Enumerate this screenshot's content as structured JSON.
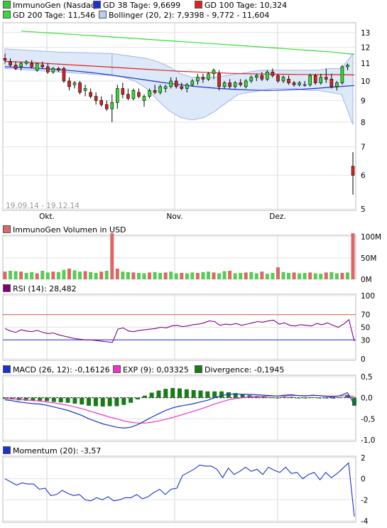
{
  "legend_main": {
    "stock": {
      "label": "ImmunoGen (Nasdaq)",
      "color": "#33cc33"
    },
    "gd38": {
      "label": "GD 38 Tage: 9,6699",
      "color": "#1a33cc"
    },
    "gd100": {
      "label": "GD 100 Tage: 10,324",
      "color": "#dd2222"
    },
    "gd200": {
      "label": "GD 200 Tage: 11,546",
      "color": "#33dd33"
    },
    "bollinger": {
      "label": "Bollinger (20, 2): 7,9398 - 9,772 - 11,604",
      "color": "#b8cff0"
    }
  },
  "date_range": "19.09.14 - 19.12.14",
  "x_labels": [
    "Okt.",
    "Nov.",
    "Dez."
  ],
  "main_y_ticks": [
    "13",
    "12",
    "11",
    "10",
    "9",
    "8",
    "7",
    "6",
    "5"
  ],
  "volume": {
    "label": "ImmunoGen Volumen in USD",
    "ticks": [
      "100M",
      "50M",
      "0M"
    ]
  },
  "rsi": {
    "label": "RSI (14): 28,482",
    "ticks": [
      "100",
      "70",
      "50",
      "30",
      "0"
    ],
    "color": "#800080"
  },
  "macd": {
    "macd_label": "MACD (26, 12): -0,16126",
    "exp_label": "EXP (9): 0,03325",
    "div_label": "Divergence: -0,1945",
    "ticks": [
      "0,5",
      "0,0",
      "-0,5",
      "-1,0"
    ],
    "macd_color": "#1a33cc",
    "exp_color": "#ee33cc",
    "div_color": "#1a7a1a"
  },
  "momentum": {
    "label": "Momentum (20): -3,57",
    "ticks": [
      "2",
      "0",
      "-2",
      "-4"
    ],
    "color": "#1a33cc"
  },
  "chart_data": [
    {
      "type": "candlestick",
      "title": "ImmunoGen (Nasdaq)",
      "x_range": [
        "19.09.14",
        "19.12.14"
      ],
      "y_range": [
        5,
        13.5
      ],
      "y_scale": "log",
      "candles": [
        {
          "o": 11.3,
          "h": 11.6,
          "l": 11.0,
          "c": 11.2
        },
        {
          "o": 11.1,
          "h": 11.3,
          "l": 10.8,
          "c": 10.9
        },
        {
          "o": 10.9,
          "h": 11.1,
          "l": 10.6,
          "c": 10.7
        },
        {
          "o": 10.8,
          "h": 11.1,
          "l": 10.6,
          "c": 11.0
        },
        {
          "o": 11.0,
          "h": 11.2,
          "l": 10.9,
          "c": 11.1
        },
        {
          "o": 11.0,
          "h": 11.2,
          "l": 10.7,
          "c": 10.8
        },
        {
          "o": 10.6,
          "h": 11.0,
          "l": 10.5,
          "c": 11.0
        },
        {
          "o": 10.9,
          "h": 11.1,
          "l": 10.7,
          "c": 10.8
        },
        {
          "o": 10.8,
          "h": 11.0,
          "l": 10.4,
          "c": 10.5
        },
        {
          "o": 10.5,
          "h": 10.8,
          "l": 10.4,
          "c": 10.7
        },
        {
          "o": 10.7,
          "h": 10.8,
          "l": 10.5,
          "c": 10.6
        },
        {
          "o": 10.7,
          "h": 10.8,
          "l": 9.9,
          "c": 10.0
        },
        {
          "o": 10.0,
          "h": 10.2,
          "l": 9.5,
          "c": 9.7
        },
        {
          "o": 9.8,
          "h": 10.0,
          "l": 9.6,
          "c": 9.9
        },
        {
          "o": 9.9,
          "h": 10.0,
          "l": 9.3,
          "c": 9.4
        },
        {
          "o": 9.5,
          "h": 9.8,
          "l": 9.2,
          "c": 9.6
        },
        {
          "o": 9.4,
          "h": 9.6,
          "l": 9.1,
          "c": 9.2
        },
        {
          "o": 9.2,
          "h": 9.4,
          "l": 8.8,
          "c": 9.0
        },
        {
          "o": 9.0,
          "h": 9.2,
          "l": 8.7,
          "c": 8.8
        },
        {
          "o": 8.8,
          "h": 9.0,
          "l": 8.5,
          "c": 8.6
        },
        {
          "o": 8.6,
          "h": 9.3,
          "l": 8.0,
          "c": 8.9
        },
        {
          "o": 8.9,
          "h": 9.8,
          "l": 8.6,
          "c": 9.6
        },
        {
          "o": 9.6,
          "h": 9.9,
          "l": 9.1,
          "c": 9.3
        },
        {
          "o": 9.3,
          "h": 9.6,
          "l": 9.0,
          "c": 9.1
        },
        {
          "o": 9.1,
          "h": 9.6,
          "l": 9.0,
          "c": 9.5
        },
        {
          "o": 9.4,
          "h": 9.6,
          "l": 9.1,
          "c": 9.2
        },
        {
          "o": 9.0,
          "h": 9.3,
          "l": 8.7,
          "c": 9.2
        },
        {
          "o": 9.2,
          "h": 9.6,
          "l": 9.1,
          "c": 9.5
        },
        {
          "o": 9.5,
          "h": 9.8,
          "l": 9.3,
          "c": 9.4
        },
        {
          "o": 9.4,
          "h": 9.8,
          "l": 9.3,
          "c": 9.7
        },
        {
          "o": 9.6,
          "h": 9.8,
          "l": 9.4,
          "c": 9.7
        },
        {
          "o": 9.7,
          "h": 10.2,
          "l": 9.6,
          "c": 10.0
        },
        {
          "o": 10.0,
          "h": 10.2,
          "l": 9.6,
          "c": 9.7
        },
        {
          "o": 9.7,
          "h": 9.9,
          "l": 9.5,
          "c": 9.6
        },
        {
          "o": 9.6,
          "h": 9.9,
          "l": 9.4,
          "c": 9.8
        },
        {
          "o": 9.8,
          "h": 10.1,
          "l": 9.7,
          "c": 10.0
        },
        {
          "o": 10.0,
          "h": 10.4,
          "l": 9.8,
          "c": 10.2
        },
        {
          "o": 10.2,
          "h": 10.4,
          "l": 9.9,
          "c": 10.1
        },
        {
          "o": 10.1,
          "h": 10.5,
          "l": 10.0,
          "c": 10.4
        },
        {
          "o": 10.4,
          "h": 10.7,
          "l": 10.1,
          "c": 10.6
        },
        {
          "o": 10.4,
          "h": 10.6,
          "l": 9.5,
          "c": 9.7
        },
        {
          "o": 9.7,
          "h": 10.0,
          "l": 9.6,
          "c": 9.9
        },
        {
          "o": 9.9,
          "h": 10.1,
          "l": 9.6,
          "c": 9.7
        },
        {
          "o": 9.7,
          "h": 10.0,
          "l": 9.6,
          "c": 9.9
        },
        {
          "o": 9.9,
          "h": 10.1,
          "l": 9.7,
          "c": 9.8
        },
        {
          "o": 9.7,
          "h": 10.1,
          "l": 9.6,
          "c": 10.0
        },
        {
          "o": 10.0,
          "h": 10.3,
          "l": 9.9,
          "c": 10.2
        },
        {
          "o": 10.2,
          "h": 10.4,
          "l": 10.0,
          "c": 10.3
        },
        {
          "o": 10.3,
          "h": 10.5,
          "l": 10.0,
          "c": 10.1
        },
        {
          "o": 10.1,
          "h": 10.6,
          "l": 10.0,
          "c": 10.5
        },
        {
          "o": 10.5,
          "h": 10.7,
          "l": 10.2,
          "c": 10.3
        },
        {
          "o": 10.3,
          "h": 10.4,
          "l": 9.9,
          "c": 10.0
        },
        {
          "o": 10.0,
          "h": 10.3,
          "l": 9.9,
          "c": 10.2
        },
        {
          "o": 10.1,
          "h": 10.3,
          "l": 9.8,
          "c": 9.9
        },
        {
          "o": 9.9,
          "h": 10.0,
          "l": 9.7,
          "c": 9.8
        },
        {
          "o": 9.8,
          "h": 10.0,
          "l": 9.7,
          "c": 9.9
        },
        {
          "o": 9.8,
          "h": 10.0,
          "l": 9.7,
          "c": 9.8
        },
        {
          "o": 9.8,
          "h": 10.4,
          "l": 9.7,
          "c": 10.3
        },
        {
          "o": 10.3,
          "h": 10.4,
          "l": 9.8,
          "c": 9.9
        },
        {
          "o": 9.9,
          "h": 10.4,
          "l": 9.8,
          "c": 10.2
        },
        {
          "o": 10.2,
          "h": 10.7,
          "l": 9.9,
          "c": 10.1
        },
        {
          "o": 10.1,
          "h": 10.4,
          "l": 9.6,
          "c": 9.7
        },
        {
          "o": 9.7,
          "h": 10.0,
          "l": 9.5,
          "c": 9.9
        },
        {
          "o": 9.9,
          "h": 10.9,
          "l": 9.8,
          "c": 10.8
        },
        {
          "o": 10.8,
          "h": 11.0,
          "l": 10.6,
          "c": 10.9
        },
        {
          "o": 6.3,
          "h": 6.8,
          "l": 5.4,
          "c": 6.0
        }
      ],
      "gd38": [
        10.8,
        10.76,
        10.7,
        10.64,
        10.56,
        10.46,
        10.34,
        10.2,
        10.06,
        9.92,
        9.8,
        9.7,
        9.62,
        9.56,
        9.52,
        9.5,
        9.52,
        9.56,
        9.62,
        9.69,
        9.76
      ],
      "gd100": [
        11.12,
        11.08,
        11.02,
        10.96,
        10.9,
        10.84,
        10.78,
        10.72,
        10.66,
        10.6,
        10.54,
        10.5,
        10.46,
        10.42,
        10.4,
        10.38,
        10.37,
        10.36,
        10.35,
        10.35,
        10.33
      ],
      "gd200": [
        13.1,
        13.0,
        12.9,
        12.8,
        12.7,
        12.6,
        12.5,
        12.4,
        12.3,
        12.2,
        12.1,
        12.0,
        11.9,
        11.8,
        11.7,
        11.55
      ],
      "bollinger_upper": [
        11.6,
        11.5,
        11.4,
        11.3,
        11.1,
        10.8,
        10.4,
        10.2,
        10.2,
        10.2,
        10.3,
        10.4,
        10.5,
        10.6,
        10.6,
        10.6,
        10.6,
        10.6,
        10.6,
        10.7,
        10.7,
        11.6
      ],
      "bollinger_lower": [
        10.3,
        10.2,
        10.0,
        9.6,
        9.0,
        8.5,
        8.2,
        8.1,
        8.2,
        8.5,
        8.9,
        9.3,
        9.4,
        9.5,
        9.6,
        9.6,
        9.6,
        9.5,
        9.5,
        9.4,
        9.3,
        7.9
      ]
    },
    {
      "type": "bar",
      "title": "ImmunoGen Volumen in USD",
      "y_range": [
        0,
        100
      ],
      "values": [
        18,
        20,
        19,
        18,
        15,
        17,
        14,
        20,
        16,
        18,
        17,
        22,
        25,
        21,
        18,
        19,
        17,
        15,
        18,
        20,
        108,
        25,
        18,
        17,
        16,
        15,
        14,
        16,
        17,
        15,
        16,
        18,
        14,
        15,
        14,
        16,
        15,
        17,
        18,
        16,
        14,
        19,
        20,
        14,
        15,
        16,
        17,
        14,
        18,
        13,
        15,
        28,
        17,
        15,
        16,
        14,
        15,
        16,
        14,
        13,
        16,
        17,
        14,
        15,
        16,
        108
      ],
      "up_color": "#55cc55",
      "down_color": "#dd6666"
    },
    {
      "type": "line",
      "title": "RSI (14): 28,482",
      "y_range": [
        0,
        100
      ],
      "reference_lines": [
        70,
        30
      ],
      "values": [
        48,
        44,
        42,
        46,
        44,
        43,
        45,
        42,
        40,
        41,
        38,
        36,
        34,
        32,
        31,
        30,
        30,
        29,
        28,
        27,
        26,
        47,
        49,
        44,
        43,
        45,
        46,
        47,
        48,
        50,
        49,
        52,
        53,
        51,
        52,
        54,
        55,
        57,
        60,
        59,
        53,
        55,
        54,
        56,
        53,
        55,
        57,
        59,
        58,
        60,
        61,
        55,
        57,
        53,
        52,
        54,
        53,
        52,
        56,
        54,
        57,
        53,
        50,
        55,
        62,
        28
      ]
    },
    {
      "type": "line",
      "title": "MACD (26, 12)",
      "y_range": [
        -1.0,
        0.5
      ],
      "series": [
        {
          "name": "MACD (26, 12): -0,16126",
          "values": [
            -0.05,
            -0.07,
            -0.1,
            -0.12,
            -0.14,
            -0.15,
            -0.18,
            -0.22,
            -0.26,
            -0.3,
            -0.36,
            -0.42,
            -0.5,
            -0.56,
            -0.62,
            -0.66,
            -0.7,
            -0.72,
            -0.7,
            -0.64,
            -0.55,
            -0.46,
            -0.38,
            -0.3,
            -0.24,
            -0.2,
            -0.17,
            -0.14,
            -0.1,
            -0.06,
            0.0,
            0.05,
            0.08,
            0.09,
            0.08,
            0.08,
            0.07,
            0.06,
            0.05,
            0.04,
            0.06,
            0.07,
            0.05,
            0.04,
            0.06,
            0.05,
            0.03,
            0.02,
            0.05,
            0.12,
            -0.16
          ]
        },
        {
          "name": "EXP (9): 0,03325",
          "values": [
            -0.02,
            -0.03,
            -0.04,
            -0.05,
            -0.07,
            -0.08,
            -0.1,
            -0.12,
            -0.15,
            -0.18,
            -0.22,
            -0.26,
            -0.31,
            -0.36,
            -0.41,
            -0.46,
            -0.5,
            -0.55,
            -0.58,
            -0.6,
            -0.6,
            -0.58,
            -0.55,
            -0.51,
            -0.47,
            -0.42,
            -0.37,
            -0.32,
            -0.27,
            -0.21,
            -0.15,
            -0.1,
            -0.05,
            -0.02,
            0.0,
            0.02,
            0.03,
            0.03,
            0.04,
            0.04,
            0.04,
            0.05,
            0.05,
            0.05,
            0.05,
            0.05,
            0.04,
            0.04,
            0.04,
            0.05,
            0.03
          ]
        },
        {
          "name": "Divergence: -0,1945",
          "values": [
            -0.03,
            -0.04,
            -0.06,
            -0.07,
            -0.07,
            -0.07,
            -0.08,
            -0.1,
            -0.11,
            -0.12,
            -0.14,
            -0.16,
            -0.19,
            -0.2,
            -0.21,
            -0.2,
            -0.2,
            -0.17,
            -0.12,
            -0.04,
            0.05,
            0.12,
            0.17,
            0.21,
            0.23,
            0.22,
            0.2,
            0.18,
            0.17,
            0.15,
            0.15,
            0.15,
            0.13,
            0.11,
            0.08,
            0.06,
            0.04,
            0.03,
            0.01,
            0.0,
            0.02,
            0.02,
            0.0,
            -0.01,
            0.01,
            0.0,
            -0.01,
            -0.02,
            0.01,
            0.07,
            -0.19
          ]
        }
      ]
    },
    {
      "type": "line",
      "title": "Momentum (20): -3,57",
      "y_range": [
        -4,
        2
      ],
      "values": [
        0,
        -0.3,
        -0.6,
        -0.4,
        -0.5,
        -0.5,
        -1.0,
        -0.9,
        -1.6,
        -1.5,
        -1.1,
        -1.4,
        -1.6,
        -1.5,
        -2.0,
        -2.1,
        -1.8,
        -2.0,
        -1.7,
        -2.1,
        -2.0,
        -1.8,
        -1.8,
        -1.5,
        -1.9,
        -1.7,
        -1.3,
        -1.0,
        -1.5,
        -1.0,
        -0.9,
        0.3,
        0.6,
        0.9,
        1.3,
        1.2,
        1.2,
        0.9,
        0.1,
        1.0,
        0.4,
        0.7,
        1.1,
        0.7,
        0.9,
        0.4,
        1.1,
        0.8,
        0.6,
        1.1,
        0.5,
        0.6,
        0.0,
        0.4,
        0.6,
        -0.1,
        0.6,
        0.1,
        0.5,
        1.0,
        1.5,
        -3.6
      ]
    }
  ]
}
